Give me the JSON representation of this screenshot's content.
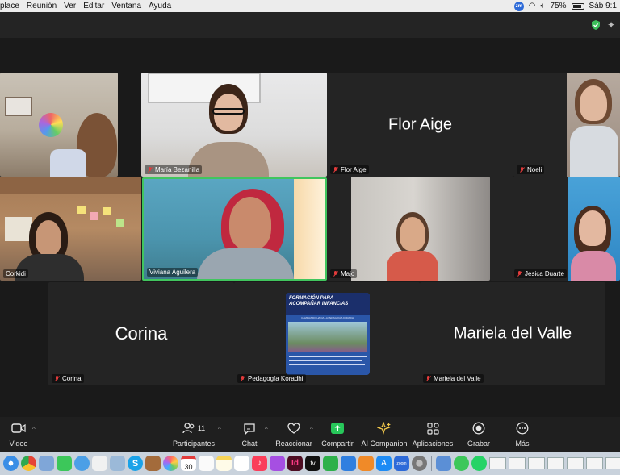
{
  "menubar": {
    "items": [
      "place",
      "Reunión",
      "Ver",
      "Editar",
      "Ventana",
      "Ayuda"
    ],
    "zoom_badge": "zm",
    "battery": "75%",
    "clock": "Sáb 9:1"
  },
  "participants": {
    "maria": "María Bezanilla",
    "flor_name": "Flor Aige",
    "flor_label": "Flor Aige",
    "noeli": "Noeli",
    "corkidi": "Corkidi",
    "viviana": "Viviana Aguilera",
    "majo": "Majo",
    "jesica": "Jesica Duarte",
    "corina_name": "Corina",
    "corina_label": "Corina",
    "koradhi": "Pedagogía Koradhi",
    "mariela_name": "Mariela del Valle",
    "mariela_label": "Mariela del Valle"
  },
  "poster": {
    "title_line1": "FORMACIÓN PARA",
    "title_line2": "ACOMPAÑAR INFANCIAS",
    "subtitle": "CAMINANDO HACIA LA PEDAGOGÍA KORADHI"
  },
  "toolbar": {
    "video": "Video",
    "participants": "Participantes",
    "participants_count": "11",
    "chat": "Chat",
    "react": "Reaccionar",
    "share": "Compartir",
    "ai": "AI Companion",
    "apps": "Aplicaciones",
    "record": "Grabar",
    "more": "Más"
  },
  "dock": {
    "calendar_day": "30",
    "tv_label": "tv",
    "zoom_label": "zoom",
    "indesign_label": "Id"
  },
  "colors": {
    "active_speaker": "#41c55e",
    "share_green": "#27c75a",
    "muted_red": "#e23b3b",
    "background": "#1a1a1a"
  }
}
